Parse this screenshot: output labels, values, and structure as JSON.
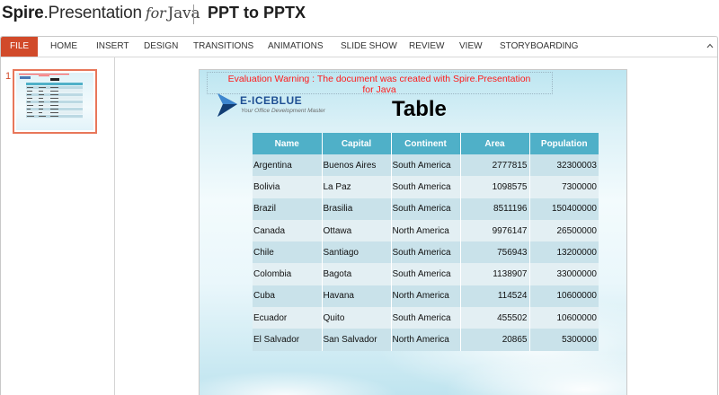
{
  "header": {
    "brand_strong": "Spire",
    "brand_light": ".Presentation",
    "brand_for": "for",
    "brand_java": "Java",
    "page_title": "PPT to PPTX"
  },
  "ribbon": {
    "tabs": [
      {
        "label": "FILE"
      },
      {
        "label": "HOME"
      },
      {
        "label": "INSERT"
      },
      {
        "label": "DESIGN"
      },
      {
        "label": "TRANSITIONS"
      },
      {
        "label": "ANIMATIONS"
      },
      {
        "label": "SLIDE SHOW"
      },
      {
        "label": "REVIEW"
      },
      {
        "label": "VIEW"
      },
      {
        "label": "STORYBOARDING"
      }
    ],
    "collapse_icon": "chevron-up-icon",
    "accent_color": "#d14a2a"
  },
  "thumbnails": {
    "items": [
      {
        "number": "1",
        "selected": true
      }
    ],
    "selection_color": "#e8775a"
  },
  "slide": {
    "warning_line1": "Evaluation Warning : The document was created with  Spire.Presentation",
    "warning_line2": "for Java",
    "logo_name": "E-ICEBLUE",
    "logo_tagline": "Your Office Development Master",
    "title": "Table",
    "header_color": "#4fb0c8",
    "table": {
      "columns": [
        "Name",
        "Capital",
        "Continent",
        "Area",
        "Population"
      ],
      "rows": [
        [
          "Argentina",
          "Buenos Aires",
          "South America",
          "2777815",
          "32300003"
        ],
        [
          "Bolivia",
          "La Paz",
          "South America",
          "1098575",
          "7300000"
        ],
        [
          "Brazil",
          "Brasilia",
          "South America",
          "8511196",
          "150400000"
        ],
        [
          "Canada",
          "Ottawa",
          "North America",
          "9976147",
          "26500000"
        ],
        [
          "Chile",
          "Santiago",
          "South America",
          "756943",
          "13200000"
        ],
        [
          "Colombia",
          "Bagota",
          "South America",
          "1138907",
          "33000000"
        ],
        [
          "Cuba",
          "Havana",
          "North America",
          "114524",
          "10600000"
        ],
        [
          "Ecuador",
          "Quito",
          "South America",
          "455502",
          "10600000"
        ],
        [
          "El Salvador",
          "San Salvador",
          "North America",
          "20865",
          "5300000"
        ]
      ]
    }
  }
}
